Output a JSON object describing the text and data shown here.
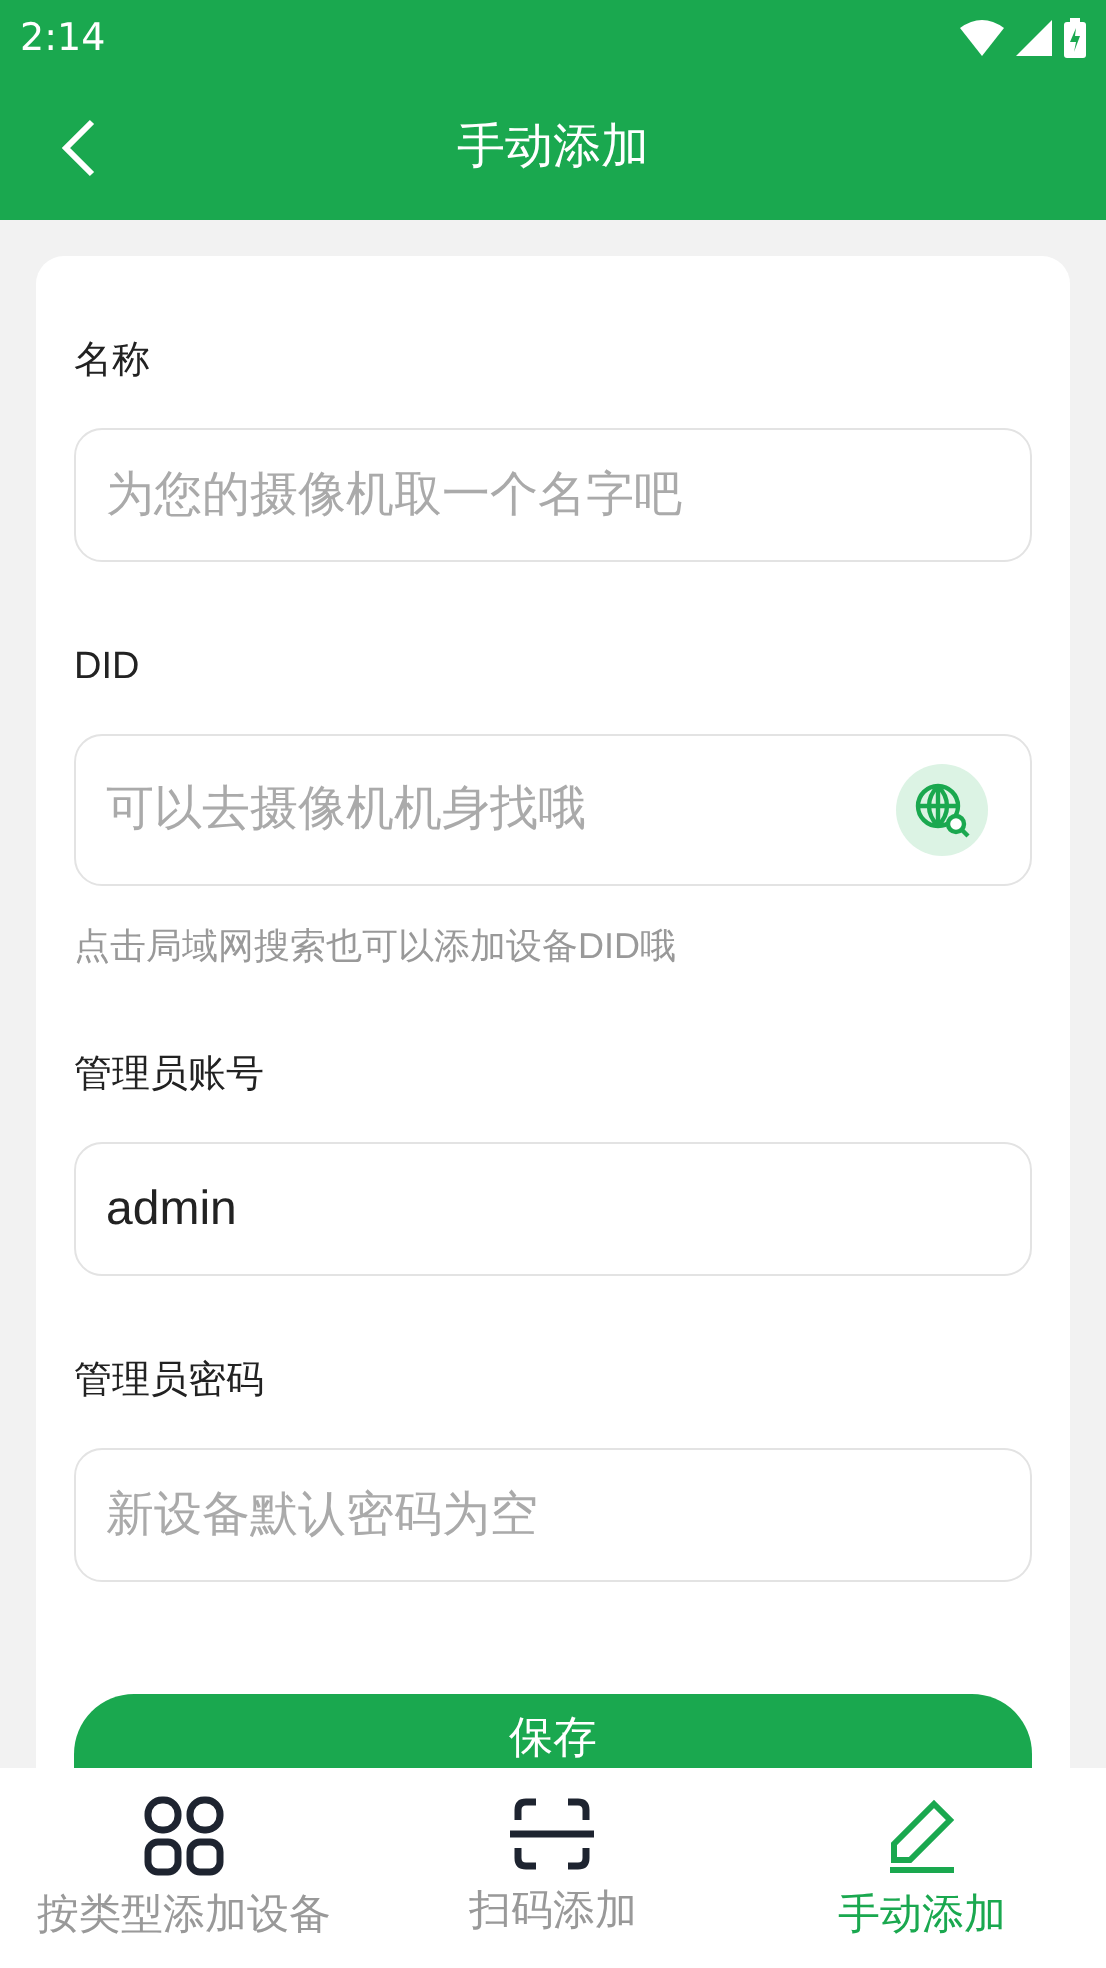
{
  "status_bar": {
    "time": "2:14"
  },
  "header": {
    "title": "手动添加"
  },
  "form": {
    "fields": [
      {
        "label": "名称",
        "placeholder": "为您的摄像机取一个名字吧"
      },
      {
        "label": "DID",
        "placeholder": "可以去摄像机机身找哦",
        "kind": "search",
        "hint": "点击局域网搜索也可以添加设备DID哦"
      },
      {
        "label": "管理员账号",
        "value": "admin"
      },
      {
        "label": "管理员密码",
        "placeholder": "新设备默认密码为空"
      }
    ],
    "submit": "保存"
  },
  "bottom_nav": [
    {
      "label": "按类型添加设备",
      "kind": "grid",
      "selected": false
    },
    {
      "label": "扫码添加",
      "kind": "scan",
      "selected": false
    },
    {
      "label": "手动添加",
      "kind": "pencil",
      "selected": true
    }
  ]
}
